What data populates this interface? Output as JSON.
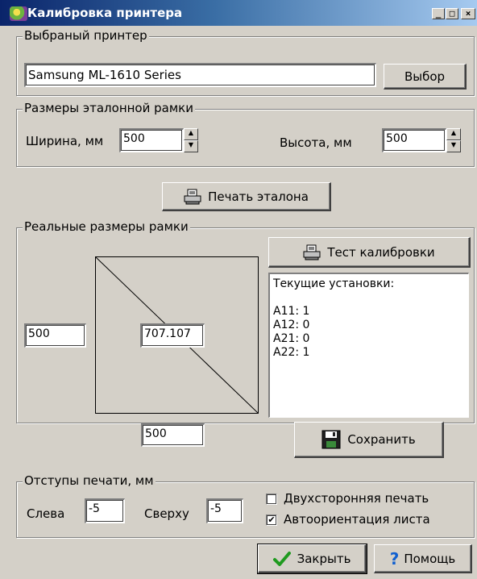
{
  "window": {
    "title": "Калибровка принтера",
    "min_glyph": "_",
    "max_glyph": "□",
    "close_glyph": "×"
  },
  "printer_group": {
    "label": "Выбраный принтер",
    "printer_name": "Samsung ML-1610 Series",
    "select_button": "Выбор"
  },
  "frame_group": {
    "label": "Размеры эталонной рамки",
    "width_label": "Ширина, мм",
    "width_value": "500",
    "height_label": "Высота, мм",
    "height_value": "500"
  },
  "print_reference_button": "Печать эталона",
  "real_group": {
    "label": "Реальные размеры рамки",
    "left_value": "500",
    "diagonal_value": "707.107",
    "bottom_value": "500",
    "test_button": "Тест калибровки",
    "settings_lines": [
      "Текущие установки:",
      "",
      "A11: 1",
      "A12: 0",
      "A21: 0",
      "A22: 1"
    ],
    "save_button": "Сохранить"
  },
  "margins_group": {
    "label": "Отступы печати, мм",
    "left_label": "Слева",
    "left_value": "-5",
    "top_label": "Сверху",
    "top_value": "-5",
    "duplex_label": "Двухсторонняя печать",
    "duplex_checked": false,
    "autorotate_label": "Автоориентация листа",
    "autorotate_checked": true
  },
  "footer": {
    "close_button": "Закрыть",
    "help_button": "Помощь"
  },
  "colors": {
    "face": "#d4d0c8",
    "title_start": "#0a246a",
    "title_end": "#a6caf0",
    "check_green": "#1f9a1f",
    "help_blue": "#1060d0"
  }
}
